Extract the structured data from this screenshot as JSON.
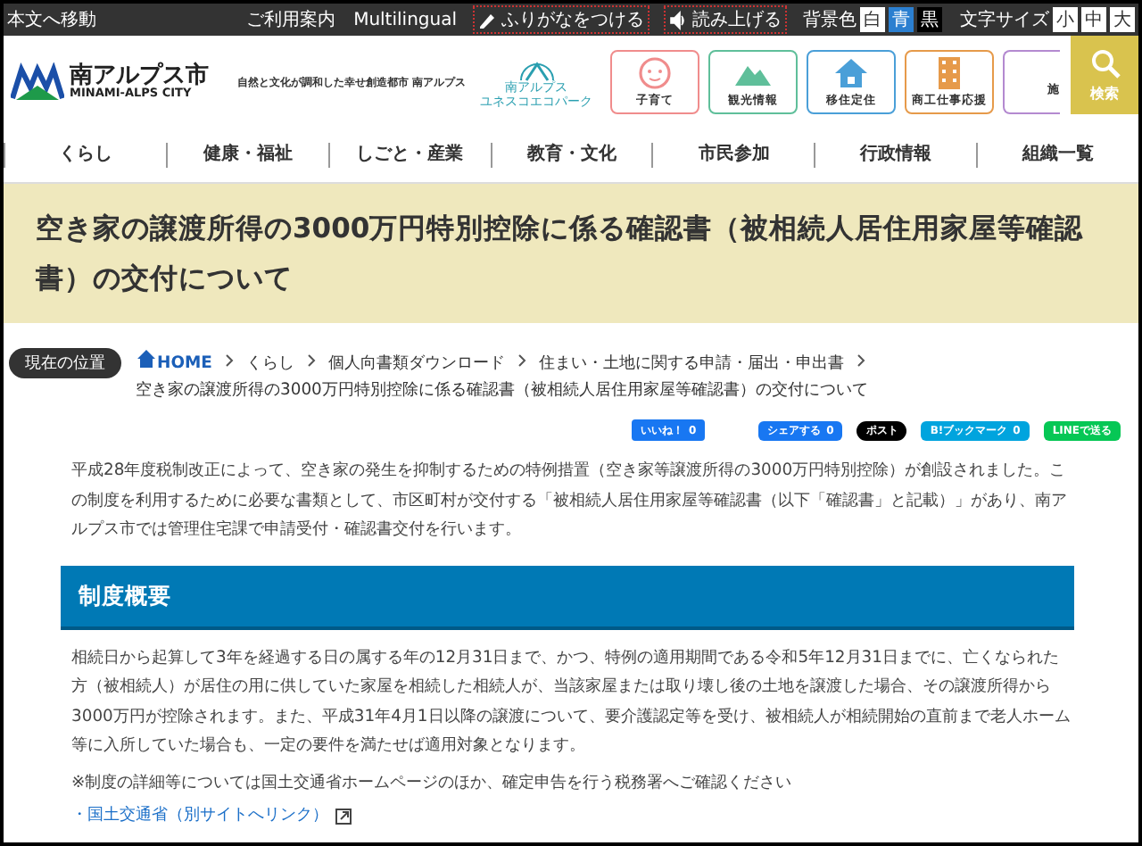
{
  "top_bar": {
    "skip_link": "本文へ移動",
    "links": [
      "ご利用案内",
      "Multilingual"
    ],
    "furigana": "ふりがなをつける",
    "read_aloud": "読み上げる",
    "bg_label": "背景色",
    "bg_options": [
      {
        "label": "白",
        "color": "#ffffff"
      },
      {
        "label": "青",
        "color": "#2b7fd0"
      },
      {
        "label": "黒",
        "color": "#000000"
      }
    ],
    "size_label": "文字サイズ",
    "size_options": [
      "小",
      "中",
      "大"
    ]
  },
  "header": {
    "logo_name": "南アルプス市",
    "logo_sub": "MINAMI-ALPS CITY",
    "tagline": "自然と文化が調和した幸せ創造都市 南アルプス",
    "eco_logo": [
      "南アルプス",
      "ユネスコエコパーク"
    ],
    "tiles": [
      {
        "label": "子育て",
        "kind": "face",
        "color": "#f08c8c"
      },
      {
        "label": "観光情報",
        "kind": "mountain",
        "color": "#5fbf9a"
      },
      {
        "label": "移住定住",
        "kind": "house",
        "color": "#4a9fd8"
      },
      {
        "label": "商工仕事応援",
        "kind": "building",
        "color": "#e69a4a"
      },
      {
        "label": "施",
        "kind": "none",
        "color": "#b48ad0"
      }
    ],
    "search_button": "検索"
  },
  "nav": [
    "くらし",
    "健康・福祉",
    "しごと・産業",
    "教育・文化",
    "市民参加",
    "行政情報",
    "組織一覧"
  ],
  "page_title": "空き家の譲渡所得の3000万円特別控除に係る確認書（被相続人居住用家屋等確認書）の交付について",
  "breadcrumb": {
    "label": "現在の位置",
    "home": "HOME",
    "items": [
      "くらし",
      "個人向書類ダウンロード",
      "住まい・土地に関する申請・届出・申出書"
    ],
    "current": "空き家の譲渡所得の3000万円特別控除に係る確認書（被相続人居住用家屋等確認書）の交付について"
  },
  "share": [
    {
      "kind": "like",
      "label": "いいね！",
      "count": "0"
    },
    {
      "kind": "facebook",
      "label": "シェアする",
      "count": "0"
    },
    {
      "kind": "x",
      "label": "ポスト"
    },
    {
      "kind": "hatena",
      "label": "B!ブックマーク",
      "count": "0"
    },
    {
      "kind": "line",
      "label": "LINEで送る"
    }
  ],
  "intro": "平成28年度税制改正によって、空き家の発生を抑制するための特例措置（空き家等譲渡所得の3000万円特別控除）が創設されました。この制度を利用するために必要な書類として、市区町村が交付する「被相続人居住用家屋等確認書（以下「確認書」と記載）」があり、南アルプス市では管理住宅課で申請受付・確認書交付を行います。",
  "section": {
    "heading": "制度概要",
    "body": "相続日から起算して3年を経過する日の属する年の12月31日まで、かつ、特例の適用期間である令和5年12月31日までに、亡くなられた方（被相続人）が居住の用に供していた家屋を相続した相続人が、当該家屋または取り壊し後の土地を譲渡した場合、その譲渡所得から3000万円が控除されます。また、平成31年4月1日以降の譲渡について、要介護認定等を受け、被相続人が相続開始の直前まで老人ホーム等に入所していた場合も、一定の要件を満たせば適用対象となります。",
    "note": "※制度の詳細等については国土交通省ホームページのほか、確定申告を行う税務署へご確認ください",
    "link": "・国土交通省（別サイトへリンク）"
  }
}
